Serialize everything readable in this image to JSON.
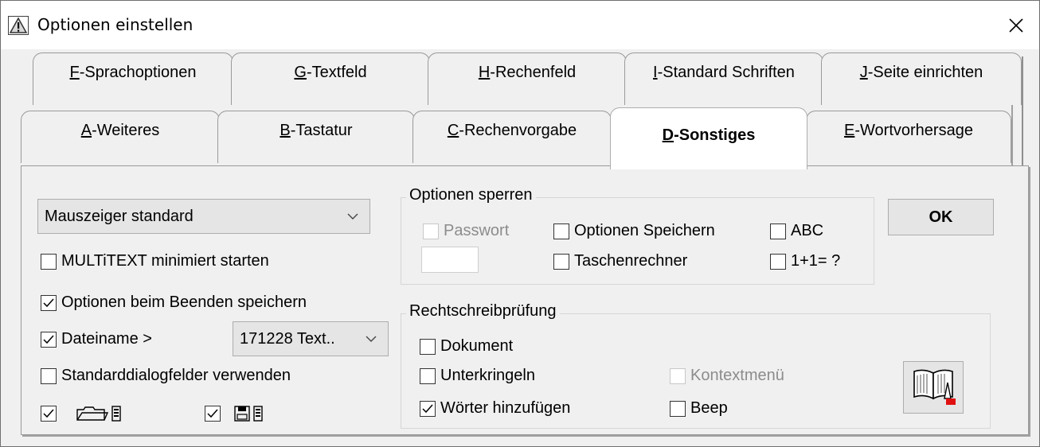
{
  "window": {
    "title": "Optionen einstellen",
    "close_glyph": "✕"
  },
  "tabs_back": [
    {
      "key": "F",
      "rest": "-Sprachoptionen"
    },
    {
      "key": "G",
      "rest": "-Textfeld"
    },
    {
      "key": "H",
      "rest": "-Rechenfeld"
    },
    {
      "key": "I",
      "rest": "-Standard Schriften"
    },
    {
      "key": "J",
      "rest": "-Seite einrichten"
    }
  ],
  "tabs_front": [
    {
      "key": "A",
      "rest": "-Weiteres"
    },
    {
      "key": "B",
      "rest": "-Tastatur"
    },
    {
      "key": "C",
      "rest": "-Rechenvorgabe"
    },
    {
      "key": "D",
      "rest": "-Sonstiges",
      "active": true
    },
    {
      "key": "E",
      "rest": "-Wortvorhersage"
    }
  ],
  "left": {
    "mouse_combo": "Mauszeiger standard",
    "multitext_min": {
      "label": "MULTiTEXT minimiert starten",
      "checked": false
    },
    "save_on_exit": {
      "label": "Optionen beim Beenden speichern",
      "checked": true
    },
    "filename": {
      "label": "Dateiname >",
      "checked": true
    },
    "filename_combo": "171228 Text..",
    "std_dialogs": {
      "label": "Standarddialogfelder verwenden",
      "checked": false
    },
    "open_icon_checked": true,
    "save_icon_checked": true
  },
  "lock_group": {
    "title": "Optionen sperren",
    "password": {
      "label": "Passwort",
      "checked": false,
      "disabled": true
    },
    "save_options": {
      "label": "Optionen Speichern",
      "checked": false
    },
    "abc": {
      "label": "ABC",
      "checked": false
    },
    "calculator": {
      "label": "Taschenrechner",
      "checked": false
    },
    "math": {
      "label": "1+1= ?",
      "checked": false
    }
  },
  "spell_group": {
    "title": "Rechtschreibprüfung",
    "document": {
      "label": "Dokument",
      "checked": false
    },
    "underline": {
      "label": "Unterkringeln",
      "checked": false
    },
    "context_menu": {
      "label": "Kontextmenü",
      "checked": false,
      "disabled": true
    },
    "add_words": {
      "label": "Wörter hinzufügen",
      "checked": true
    },
    "beep": {
      "label": "Beep",
      "checked": false
    }
  },
  "ok_button": "OK",
  "icons": [
    "warning-icon",
    "close-icon",
    "chevron-down-icon",
    "folder-open-icon",
    "save-disk-icon",
    "dictionary-book-icon"
  ]
}
